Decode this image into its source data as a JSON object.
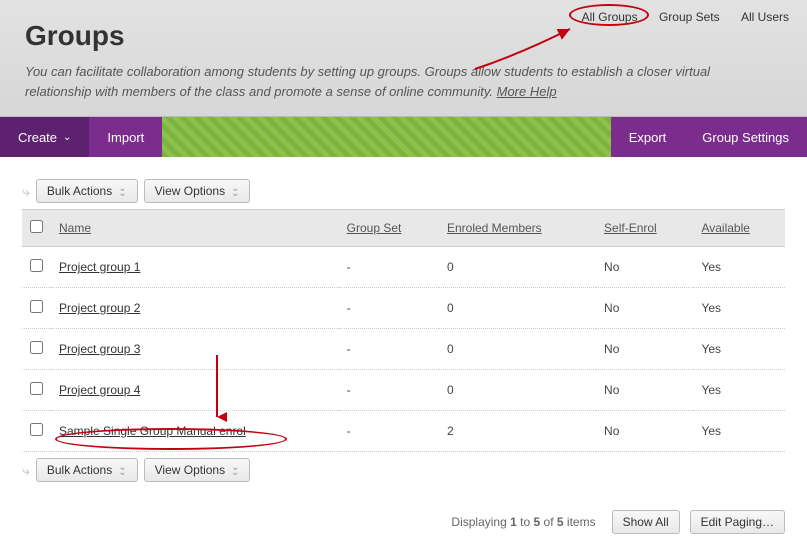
{
  "topNav": {
    "allGroups": "All Groups",
    "groupSets": "Group Sets",
    "allUsers": "All Users"
  },
  "header": {
    "title": "Groups",
    "desc1": "You can facilitate collaboration among students by setting up groups. Groups allow students to establish a closer virtual relationship with members of the class and promote a sense of online community. ",
    "moreHelp": "More Help"
  },
  "actionBar": {
    "create": "Create",
    "import": "Import",
    "export": "Export",
    "groupSettings": "Group Settings"
  },
  "toolbar": {
    "bulkActions": "Bulk Actions",
    "viewOptions": "View Options"
  },
  "table": {
    "headers": {
      "name": "Name",
      "groupSet": "Group Set",
      "enrolled": "Enroled Members",
      "selfEnrol": "Self-Enrol",
      "available": "Available"
    },
    "rows": [
      {
        "name": "Project group 1",
        "groupSet": "-",
        "enrolled": "0",
        "selfEnrol": "No",
        "available": "Yes"
      },
      {
        "name": "Project group 2",
        "groupSet": "-",
        "enrolled": "0",
        "selfEnrol": "No",
        "available": "Yes"
      },
      {
        "name": "Project group 3",
        "groupSet": "-",
        "enrolled": "0",
        "selfEnrol": "No",
        "available": "Yes"
      },
      {
        "name": "Project group 4",
        "groupSet": "-",
        "enrolled": "0",
        "selfEnrol": "No",
        "available": "Yes"
      },
      {
        "name": "Sample Single Group Manual enrol",
        "groupSet": "-",
        "enrolled": "2",
        "selfEnrol": "No",
        "available": "Yes"
      }
    ]
  },
  "footer": {
    "displayPrefix": "Displaying ",
    "displayFrom": "1",
    "displayTo": " to ",
    "displayToNum": "5",
    "displayOf": " of ",
    "displayTotal": "5",
    "displaySuffix": " items",
    "showAll": "Show All",
    "editPaging": "Edit Paging…"
  }
}
